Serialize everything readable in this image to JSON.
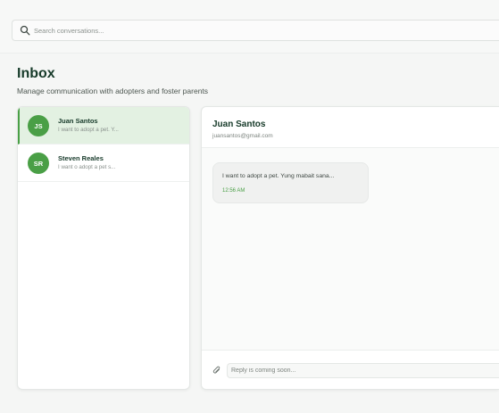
{
  "search": {
    "placeholder": "Search conversations...",
    "icon": "search-icon"
  },
  "page": {
    "title": "Inbox",
    "subtitle": "Manage communication with adopters and foster parents"
  },
  "conversations": [
    {
      "initials": "JS",
      "name": "Juan Santos",
      "preview": "I want to adopt a pet. Y...",
      "active": true
    },
    {
      "initials": "SR",
      "name": "Steven Reales",
      "preview": "I want o adopt a pet s...",
      "active": false
    }
  ],
  "chat": {
    "name": "Juan Santos",
    "email": "juansantos@gmail.com",
    "messages": [
      {
        "text": "I want to adopt a pet. Yung mabait sana...",
        "time": "12:56 AM"
      }
    ],
    "reply_placeholder": "Reply is coming soon..."
  },
  "colors": {
    "accent": "#4a9f46",
    "active_bg": "#e3f1e2",
    "title": "#163a29"
  }
}
